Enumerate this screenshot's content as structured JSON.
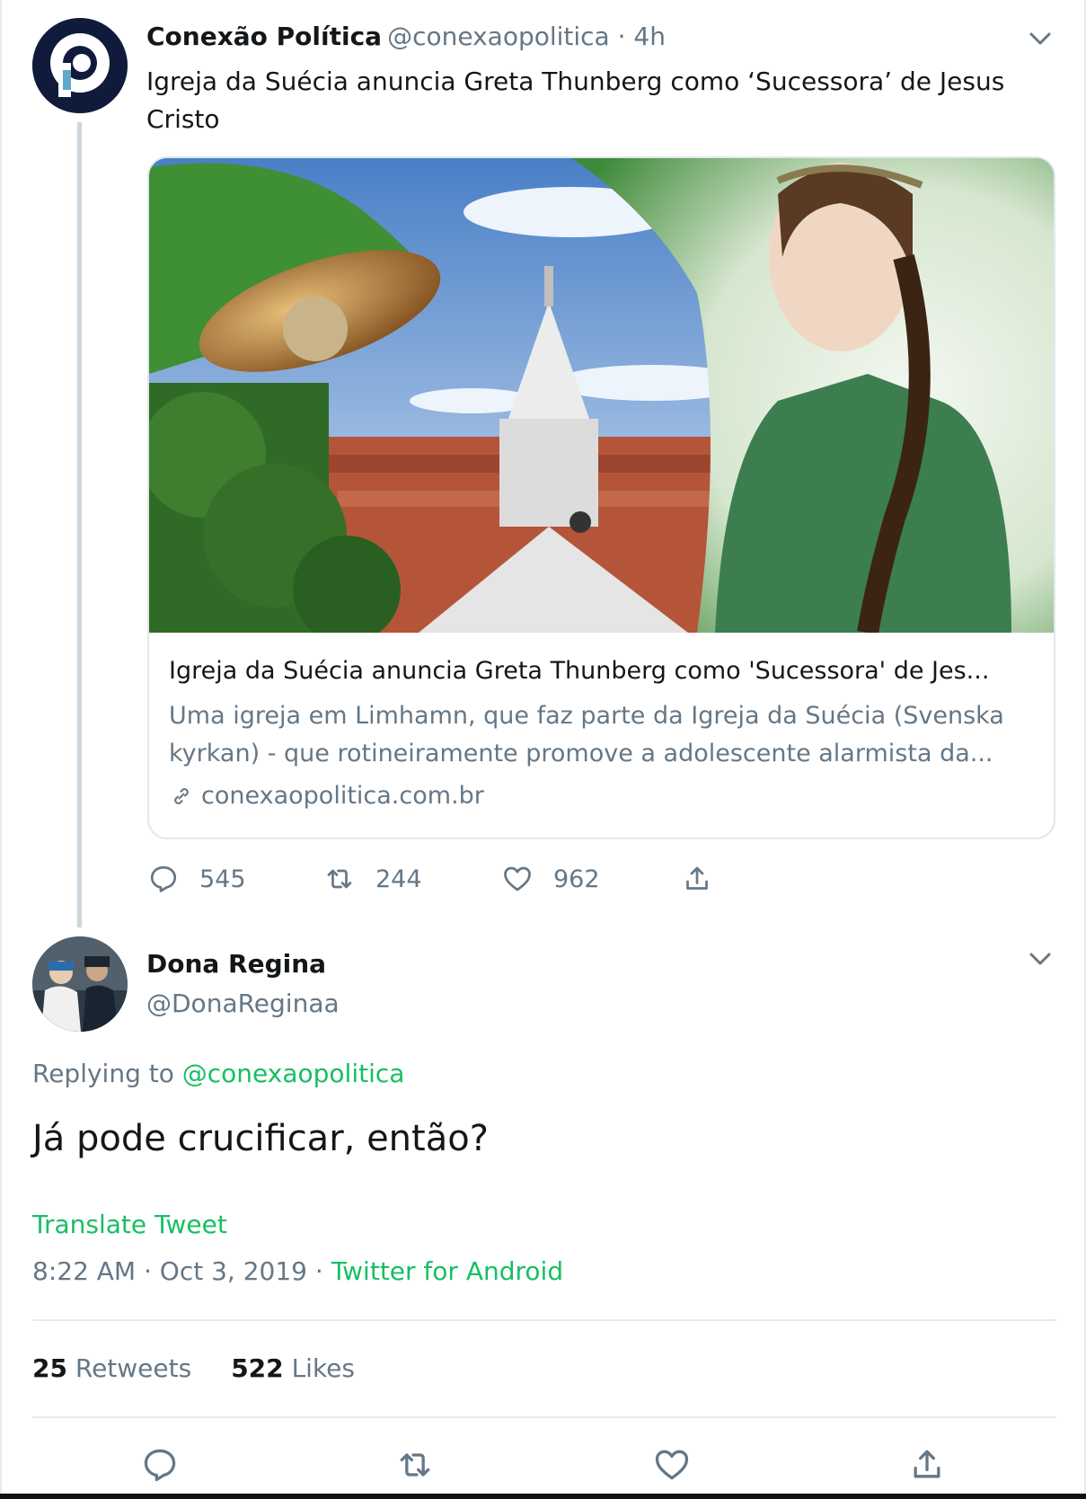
{
  "tweet": {
    "name": "Conexão Política",
    "handle": "@conexaopolitica · 4h",
    "text": "Igreja da Suécia anuncia Greta Thunberg como ‘Sucessora’ de Jesus Cristo",
    "card": {
      "title": "Igreja da Suécia anuncia Greta Thunberg como 'Sucessora' de Jes...",
      "description": "Uma igreja em Limhamn, que faz parte da Igreja da Suécia (Svenska kyrkan) - que rotineiramente promove a adolescente alarmista da...",
      "domain": "conexaopolitica.com.br"
    },
    "replies": "545",
    "retweets": "244",
    "likes": "962"
  },
  "reply": {
    "name": "Dona Regina",
    "handle": "@DonaReginaa",
    "replying_label": "Replying to",
    "replying_handle": "@conexaopolitica",
    "text": "Já pode crucificar, então?",
    "translate": "Translate Tweet",
    "timestamp": "8:22 AM · Oct 3, 2019 · ",
    "source": "Twitter for Android",
    "retweet_count": "25",
    "retweet_label": "Retweets",
    "like_count": "522",
    "like_label": "Likes"
  },
  "colors": {
    "accent": "#17bf63",
    "secondary_text": "#657786",
    "border": "#e6ecf0"
  },
  "icons": [
    "chevron-down-icon",
    "reply-icon",
    "retweet-icon",
    "like-icon",
    "share-icon",
    "link-icon"
  ]
}
